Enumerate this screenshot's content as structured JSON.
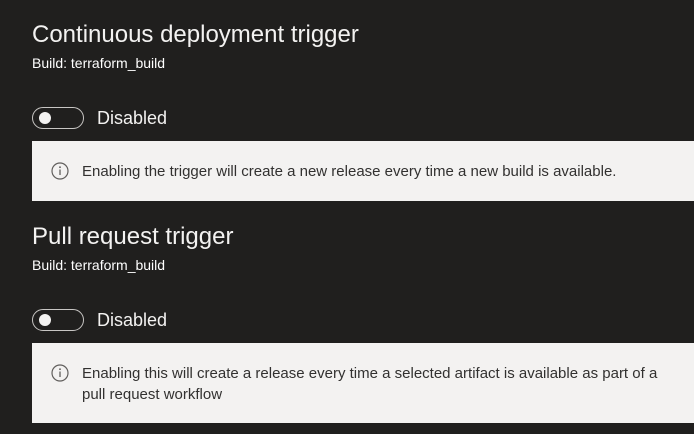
{
  "continuous_trigger": {
    "title": "Continuous deployment trigger",
    "build_label": "Build: terraform_build",
    "toggle_state": "Disabled",
    "info_icon": "info-icon",
    "info_text": "Enabling the trigger will create a new release every time a new build is available."
  },
  "pr_trigger": {
    "title": "Pull request trigger",
    "build_label": "Build: terraform_build",
    "toggle_state": "Disabled",
    "info_icon": "info-icon",
    "info_text": "Enabling this will create a release every time a selected artifact is available as part of a pull request workflow"
  },
  "colors": {
    "background": "#201f1e",
    "infobox_background": "#f3f2f1",
    "text": "#f3f2f1",
    "info_text": "#323130"
  }
}
